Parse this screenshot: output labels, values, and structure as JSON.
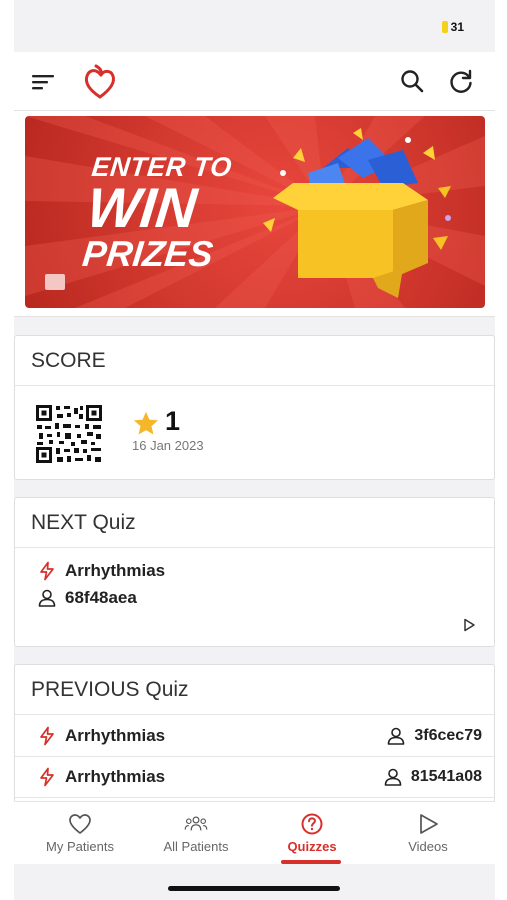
{
  "status_bar": {
    "battery": "31"
  },
  "banner": {
    "line1": "ENTER TO",
    "line2": "WIN",
    "line3": "PRIZES"
  },
  "score": {
    "title": "SCORE",
    "value": "1",
    "date": "16 Jan 2023"
  },
  "next_quiz": {
    "title": "NEXT Quiz",
    "topic": "Arrhythmias",
    "code": "68f48aea"
  },
  "previous_quiz": {
    "title": "PREVIOUS Quiz",
    "items": [
      {
        "topic": "Arrhythmias",
        "code": "3f6cec79"
      },
      {
        "topic": "Arrhythmias",
        "code": "81541a08"
      }
    ]
  },
  "tabs": [
    {
      "label": "My Patients",
      "icon": "heart-icon",
      "active": false
    },
    {
      "label": "All Patients",
      "icon": "people-icon",
      "active": false
    },
    {
      "label": "Quizzes",
      "icon": "question-icon",
      "active": true
    },
    {
      "label": "Videos",
      "icon": "play-icon",
      "active": false
    }
  ],
  "colors": {
    "accent": "#d7302a",
    "banner_red": "#d43a30",
    "star": "#f5b62a"
  }
}
